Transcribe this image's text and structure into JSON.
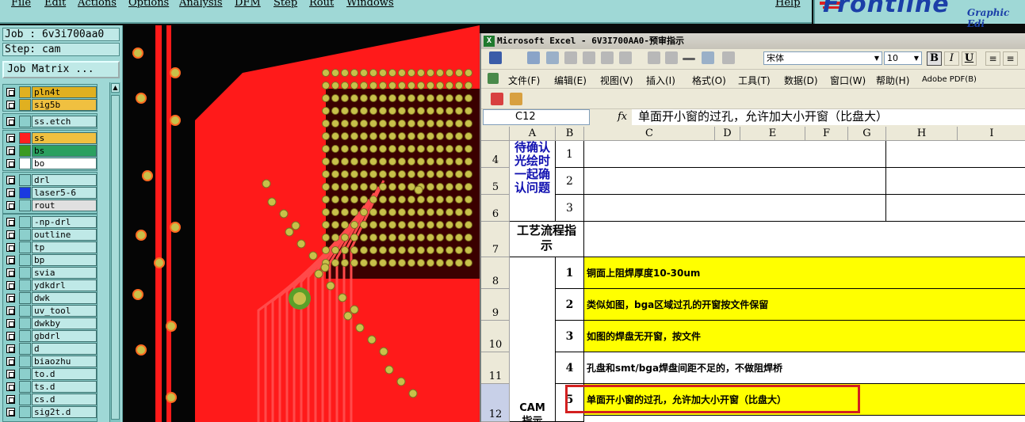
{
  "menubar": {
    "items": [
      "File",
      "Edit",
      "Actions",
      "Options",
      "Analysis",
      "DFM",
      "Step",
      "Rout",
      "Windows"
    ],
    "help": "Help"
  },
  "logo": {
    "brand": "Frontline",
    "subtitle": "Graphic Edi"
  },
  "job": {
    "job_line": "Job : 6v3i700aa0",
    "step_line": "Step: cam",
    "matrix_button": "Job Matrix ..."
  },
  "layers": [
    {
      "name": "pln4t",
      "color": "#e0b020",
      "label_bg": "#e0b020"
    },
    {
      "name": "sig5b",
      "color": "#e0b020",
      "label_bg": "#f0c040"
    },
    {
      "name": "ss.etch",
      "color": "#8ccfcc",
      "label_bg": "#bfe9e7"
    },
    {
      "name": "ss",
      "color": "#ff2020",
      "label_bg": "#f0c040"
    },
    {
      "name": "bs",
      "color": "#3a9a20",
      "label_bg": "#2aa060"
    },
    {
      "name": "bo",
      "color": "#ffffff",
      "label_bg": "#ffffff"
    },
    {
      "name": "drl",
      "color": "#8ccfcc",
      "label_bg": "#bfe9e7"
    },
    {
      "name": "laser5-6",
      "color": "#1a3ae0",
      "label_bg": "#bfe9e7"
    },
    {
      "name": "rout",
      "color": "#8ccfcc",
      "label_bg": "#e0e0e0"
    },
    {
      "name": "-np-drl",
      "color": "#8ccfcc",
      "label_bg": "#bfe9e7"
    },
    {
      "name": "outline",
      "color": "#8ccfcc",
      "label_bg": "#bfe9e7"
    },
    {
      "name": "tp",
      "color": "#8ccfcc",
      "label_bg": "#bfe9e7"
    },
    {
      "name": "bp",
      "color": "#8ccfcc",
      "label_bg": "#bfe9e7"
    },
    {
      "name": "svia",
      "color": "#8ccfcc",
      "label_bg": "#bfe9e7"
    },
    {
      "name": "ydkdrl",
      "color": "#8ccfcc",
      "label_bg": "#bfe9e7"
    },
    {
      "name": "dwk",
      "color": "#8ccfcc",
      "label_bg": "#bfe9e7"
    },
    {
      "name": "uv_tool",
      "color": "#8ccfcc",
      "label_bg": "#bfe9e7"
    },
    {
      "name": "dwkby",
      "color": "#8ccfcc",
      "label_bg": "#bfe9e7"
    },
    {
      "name": "gbdrl",
      "color": "#8ccfcc",
      "label_bg": "#bfe9e7"
    },
    {
      "name": "d",
      "color": "#8ccfcc",
      "label_bg": "#bfe9e7"
    },
    {
      "name": "biaozhu",
      "color": "#8ccfcc",
      "label_bg": "#bfe9e7"
    },
    {
      "name": "to.d",
      "color": "#8ccfcc",
      "label_bg": "#bfe9e7"
    },
    {
      "name": "ts.d",
      "color": "#8ccfcc",
      "label_bg": "#bfe9e7"
    },
    {
      "name": "cs.d",
      "color": "#8ccfcc",
      "label_bg": "#bfe9e7"
    },
    {
      "name": "sig2t.d",
      "color": "#8ccfcc",
      "label_bg": "#bfe9e7"
    }
  ],
  "excel": {
    "title": "Microsoft Excel - 6V3I700AA0-预审指示",
    "font_name": "宋体",
    "font_size": "10",
    "bold": "B",
    "italic": "I",
    "underline": "U",
    "menus": [
      "文件(F)",
      "编辑(E)",
      "视图(V)",
      "插入(I)",
      "格式(O)",
      "工具(T)",
      "数据(D)",
      "窗口(W)",
      "帮助(H)",
      "Adobe PDF(B)"
    ],
    "name_box": "C12",
    "fx": "fx",
    "formula": "单面开小窗的过孔，允许加大小开窗（比盘大）",
    "columns": [
      "A",
      "B",
      "C",
      "D",
      "E",
      "F",
      "G",
      "H",
      "I"
    ],
    "rows": [
      "4",
      "5",
      "6",
      "7",
      "8",
      "9",
      "10",
      "11",
      "12"
    ],
    "a_confirm": "待确认光绘时一起确认问题",
    "a_process": "工艺流程指示",
    "a_cam": "CAM指示",
    "b_nums": [
      "1",
      "2",
      "3",
      "1",
      "2",
      "3",
      "4",
      "5"
    ],
    "notes": [
      "铜面上阻焊厚度10-30um",
      "类似如图，bga区域过孔的开窗按文件保留",
      "如图的焊盘无开窗，按文件",
      "孔盘和smt/bga焊盘间距不足的，不做阻焊桥",
      "单面开小窗的过孔，允许加大小开窗（比盘大）"
    ]
  }
}
